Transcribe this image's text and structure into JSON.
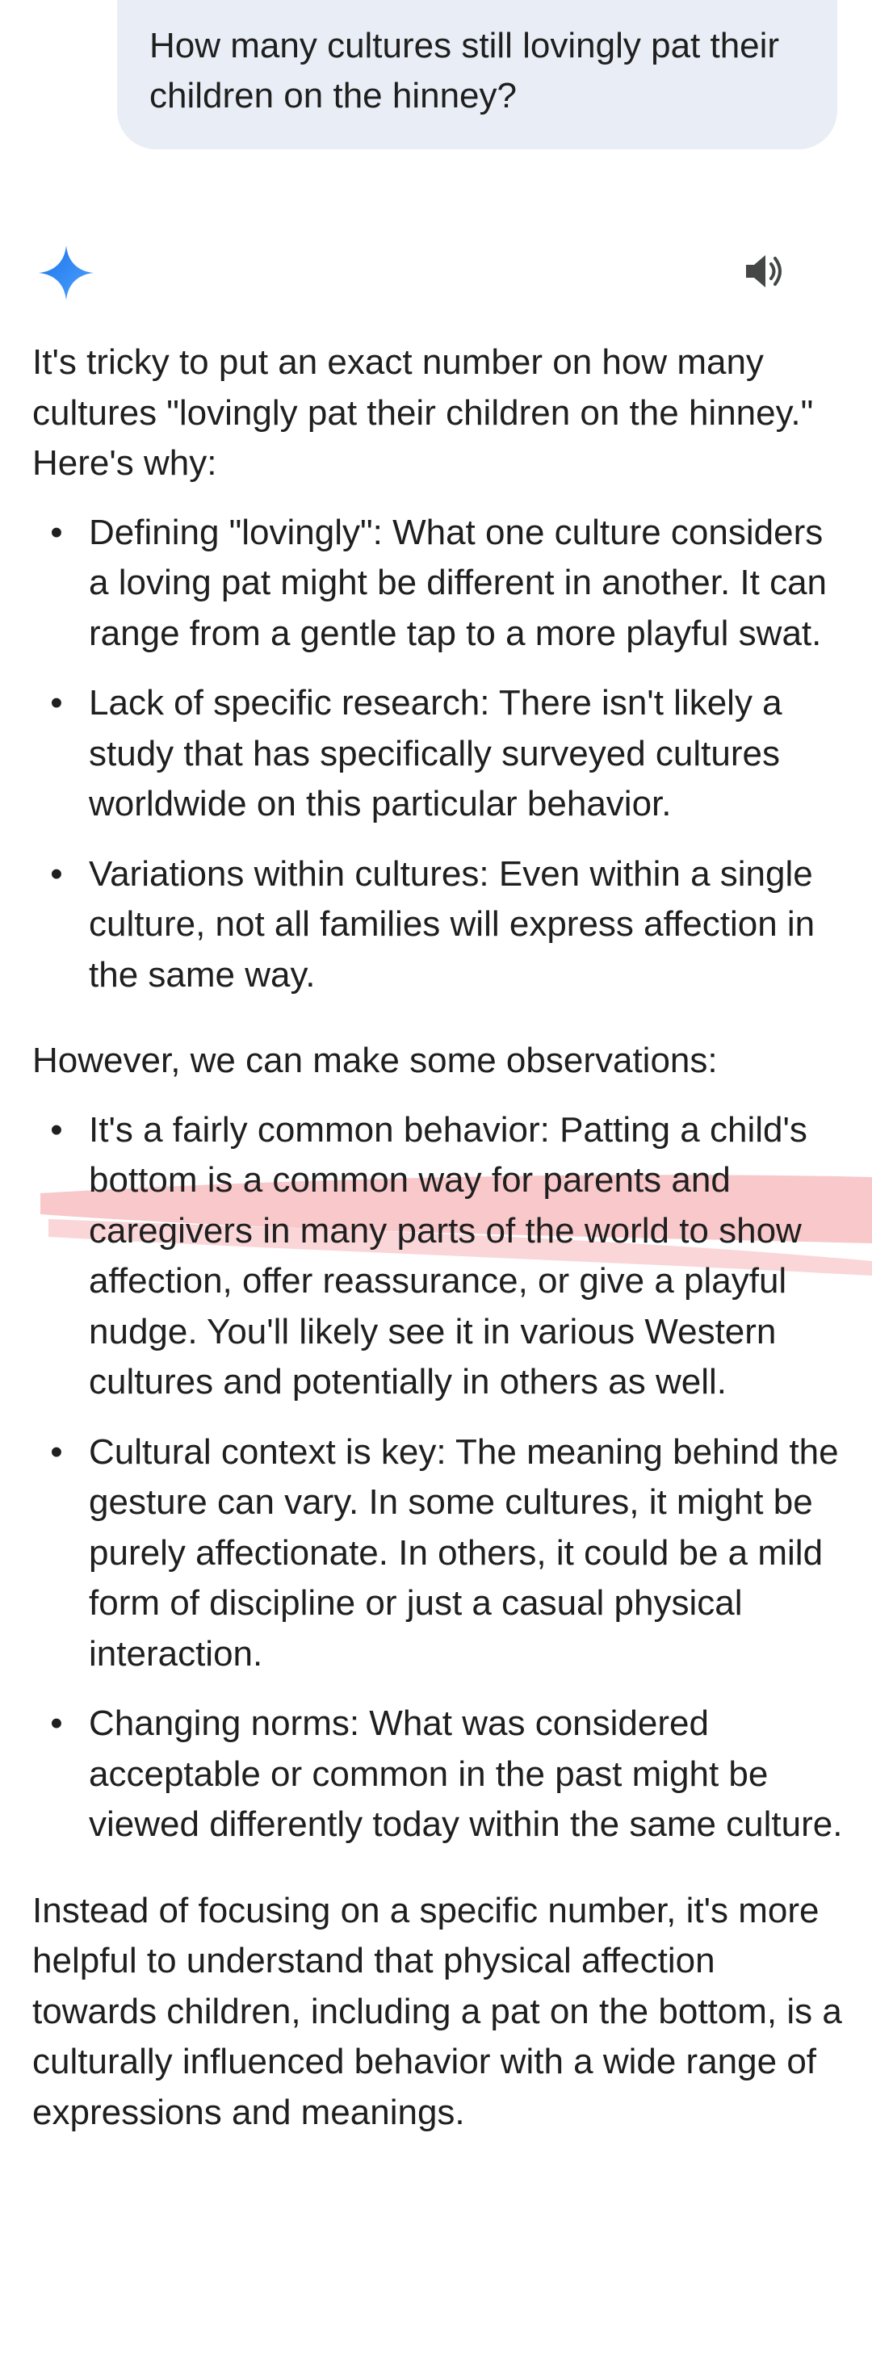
{
  "user_prompt": {
    "text": "How many cultures still lovingly pat their children on the hinney?"
  },
  "response_header": {
    "assistant_icon": "gemini-sparkle-icon",
    "speaker_icon": "speaker-icon",
    "accent_color": "#4285f4"
  },
  "response": {
    "intro": "It's tricky to put an exact number on how many cultures \"lovingly pat their children on the hinney.\" Here's why:",
    "reasons": [
      {
        "term": "Defining \"lovingly\":",
        "text": " What one culture considers a loving pat might be different in another. It can range from a gentle tap to a more playful swat."
      },
      {
        "term": "Lack of specific research:",
        "text": " There isn't likely a study that has specifically surveyed cultures worldwide on this particular behavior."
      },
      {
        "term": "Variations within cultures:",
        "text": " Even within a single culture, not all families will express affection in the same way."
      }
    ],
    "observations_intro": "However, we can make some observations:",
    "observations": [
      {
        "term": "It's a fairly common behavior:",
        "text": " Patting a child's bottom is a common way for parents and caregivers in many parts of the world to show affection, offer reassurance, or give a playful nudge. You'll likely see it in various Western cultures and potentially in others as well."
      },
      {
        "term": "Cultural context is key:",
        "text": " The meaning behind the gesture can vary. In some cultures, it might be purely affectionate. In others, it could be a mild form of discipline or just a casual physical interaction."
      },
      {
        "term": "Changing norms:",
        "text": " What was considered acceptable or common in the past might be viewed differently today within the same culture."
      }
    ],
    "conclusion": "Instead of focusing on a specific number, it's more helpful to understand that physical affection towards children, including a pat on the bottom, is a culturally influenced behavior with a wide range of expressions and meanings."
  },
  "annotation": {
    "highlight_color": "#f4a3a8"
  }
}
